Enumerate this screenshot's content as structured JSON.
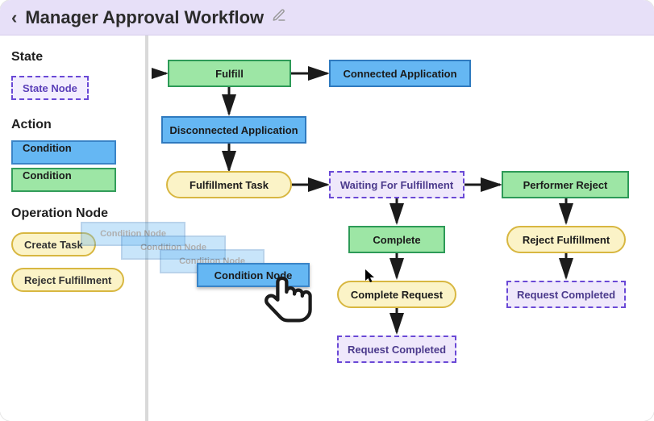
{
  "header": {
    "title": "Manager Approval Workflow"
  },
  "palette": {
    "section_state": "State",
    "state_template": "State Node",
    "section_action": "Action",
    "condition_blue": "Condition",
    "condition_green": "Condition",
    "section_op": "Operation Node",
    "op_create_task": "Create Task",
    "op_reject_fulfillment": "Reject Fulfillment"
  },
  "drag": {
    "ghost1": "Condition Node",
    "ghost2": "Condition Node",
    "ghost3": "Condition Node",
    "active": "Condition Node"
  },
  "nodes": {
    "fulfill": "Fulfill",
    "connected_app": "Connected Application",
    "disconnected_app": "Disconnected Application",
    "fulfillment_task": "Fulfillment Task",
    "waiting_fulfillment": "Waiting For Fulfillment",
    "performer_reject": "Performer Reject",
    "complete": "Complete",
    "reject_fulfillment": "Reject Fulfillment",
    "complete_request": "Complete Request",
    "request_completed_left": "Request Completed",
    "request_completed_right": "Request Completed"
  }
}
